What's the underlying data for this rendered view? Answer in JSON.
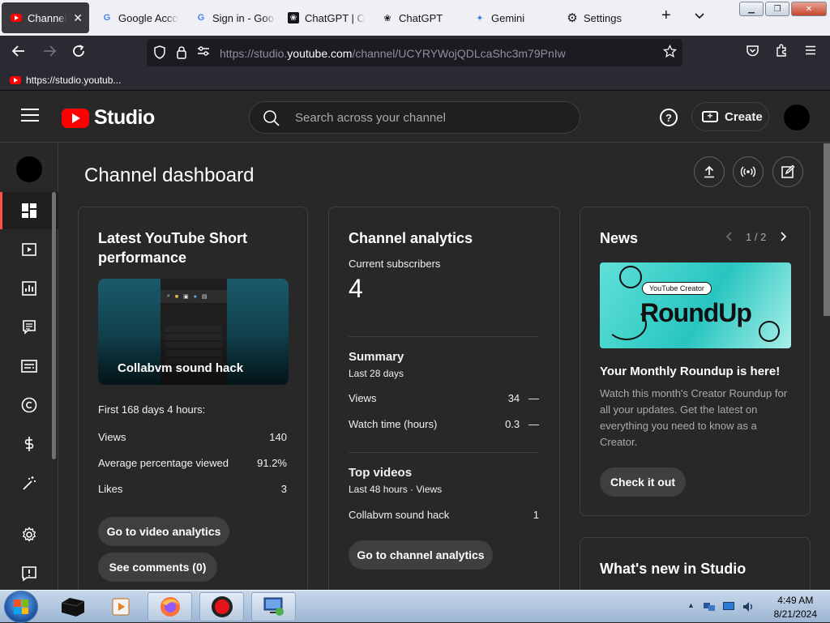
{
  "browser": {
    "tabs": [
      {
        "label": "Channel d",
        "icon": "youtube-favicon",
        "active": true
      },
      {
        "label": "Google Acco",
        "icon": "google-favicon"
      },
      {
        "label": "Sign in - Goo",
        "icon": "google-favicon"
      },
      {
        "label": "ChatGPT | Op",
        "icon": "chatgpt-favicon"
      },
      {
        "label": "ChatGPT",
        "icon": "chatgpt-favicon"
      },
      {
        "label": "Gemini",
        "icon": "gemini-favicon"
      },
      {
        "label": "Settings",
        "icon": "gear-icon"
      }
    ],
    "url_prefix": "https://studio.",
    "url_domain": "youtube.com",
    "url_path": "/channel/UCYRYWojQDLcaShc3m79PnIw",
    "bookmark": "https://studio.youtub..."
  },
  "studio": {
    "logo_text": "Studio",
    "search_placeholder": "Search across your channel",
    "create_label": "Create",
    "page_title": "Channel dashboard"
  },
  "short_card": {
    "title": "Latest YouTube Short performance",
    "thumb_caption": "Collabvm sound hack",
    "period": "First 168 days 4 hours:",
    "stats": [
      {
        "label": "Views",
        "value": "140"
      },
      {
        "label": "Average percentage viewed",
        "value": "91.2%"
      },
      {
        "label": "Likes",
        "value": "3"
      }
    ],
    "btn_analytics": "Go to video analytics",
    "btn_comments": "See comments (0)"
  },
  "analytics_card": {
    "title": "Channel analytics",
    "subs_label": "Current subscribers",
    "subs_value": "4",
    "summary_title": "Summary",
    "summary_period": "Last 28 days",
    "summary_rows": [
      {
        "label": "Views",
        "value": "34",
        "trend": "—"
      },
      {
        "label": "Watch time (hours)",
        "value": "0.3",
        "trend": "—"
      }
    ],
    "top_title": "Top videos",
    "top_period": "Last 48 hours · Views",
    "top_rows": [
      {
        "label": "Collabvm sound hack",
        "value": "1"
      }
    ],
    "btn": "Go to channel analytics"
  },
  "news_card": {
    "title": "News",
    "pager": "1 / 2",
    "image_badge": "YouTube Creator",
    "image_title": "RoundUp",
    "headline": "Your Monthly Roundup is here!",
    "body": "Watch this month's Creator Roundup for all your updates. Get the latest on everything you need to know as a Creator.",
    "btn": "Check it out"
  },
  "whats_new_card": {
    "title": "What's new in Studio"
  },
  "taskbar": {
    "time": "4:49 AM",
    "date": "8/21/2024"
  }
}
